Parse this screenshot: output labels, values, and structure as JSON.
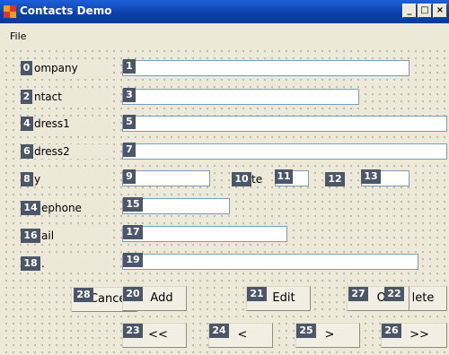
{
  "window": {
    "title": "Contacts Demo",
    "minimize": "_",
    "maximize": "□",
    "close": "×"
  },
  "menu": {
    "file": "File"
  },
  "labels": {
    "company": "ompany",
    "contact": "ntact",
    "address1": "dress1",
    "address2": "dress2",
    "city": "y",
    "state": "te",
    "telephone": "ephone",
    "email": "ail",
    "notes": "."
  },
  "badges": [
    "0",
    "1",
    "2",
    "3",
    "4",
    "5",
    "6",
    "7",
    "8",
    "9",
    "10",
    "11",
    "12",
    "13",
    "14",
    "15",
    "16",
    "17",
    "18",
    "19",
    "20",
    "21",
    "22",
    "23",
    "24",
    "25",
    "26",
    "27",
    "28"
  ],
  "buttons": {
    "cancel": "Cancel",
    "add": "Add",
    "edit": "Edit",
    "ok": "OK",
    "delete": "lete",
    "first": "<<",
    "prev": "<",
    "next": ">",
    "last": ">>"
  }
}
